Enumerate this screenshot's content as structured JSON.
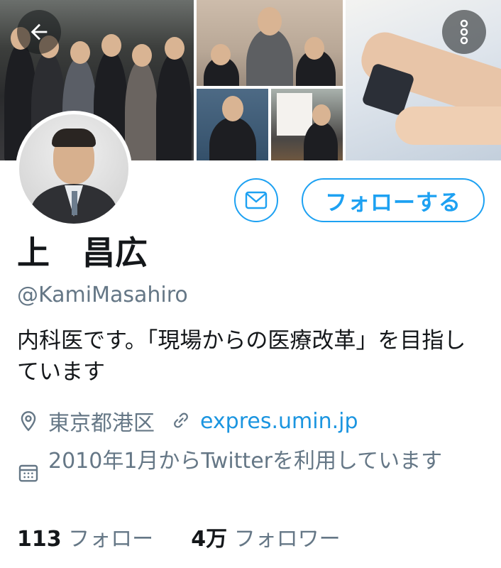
{
  "header": {
    "back_icon": "arrow-left-icon",
    "more_icon": "more-vertical-icon"
  },
  "profile": {
    "name": "上　昌広",
    "handle": "@KamiMasahiro",
    "bio": "内科医です。「現場からの医療改革」を目指しています",
    "location": "東京都港区",
    "url": "expres.umin.jp",
    "joined": "2010年1月からTwitterを利用しています"
  },
  "actions": {
    "message_icon": "envelope-icon",
    "follow_label": "フォローする"
  },
  "stats": {
    "following_count": "113",
    "following_label": "フォロー",
    "followers_count": "4万",
    "followers_label": "フォロワー"
  },
  "colors": {
    "accent": "#1da1f2",
    "link": "#1b95e0",
    "secondary_text": "#657786",
    "primary_text": "#14171a"
  }
}
